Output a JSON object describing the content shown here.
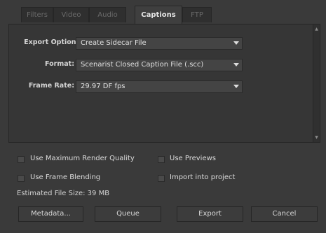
{
  "tabs": [
    "Filters",
    "Video",
    "Audio",
    "Captions",
    "FTP"
  ],
  "active_tab": "Captions",
  "export_options": {
    "label": "Export Options:",
    "value": "Create Sidecar File"
  },
  "format": {
    "label": "Format:",
    "value": "Scenarist Closed Caption File (.scc)"
  },
  "frame_rate": {
    "label": "Frame Rate:",
    "value": "29.97 DF fps"
  },
  "options": {
    "max_render_quality": "Use Maximum Render Quality",
    "use_previews": "Use Previews",
    "frame_blending": "Use Frame Blending",
    "import_into_project": "Import into project"
  },
  "estimated_size": "Estimated File Size:  39 MB",
  "buttons": {
    "metadata": "Metadata...",
    "queue": "Queue",
    "export": "Export",
    "cancel": "Cancel"
  }
}
